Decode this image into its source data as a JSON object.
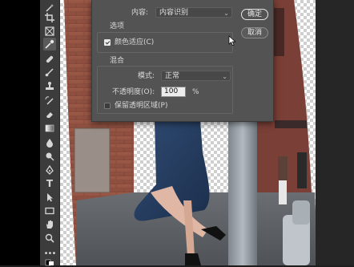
{
  "fill_dialog": {
    "contents_label": "内容:",
    "contents_value": "内容识别",
    "options_title": "选项",
    "color_adapt_label": "颜色适应(C)",
    "color_adapt_checked": true,
    "blending_title": "混合",
    "mode_label": "模式:",
    "mode_value": "正常",
    "opacity_label": "不透明度(O):",
    "opacity_value": "100",
    "opacity_unit": "%",
    "preserve_label": "保留透明区域(P)",
    "preserve_checked": false,
    "ok_label": "确定",
    "cancel_label": "取消"
  },
  "colors": {
    "dialog_bg": "#535353",
    "toolbar_bg": "#3c3c3c"
  }
}
